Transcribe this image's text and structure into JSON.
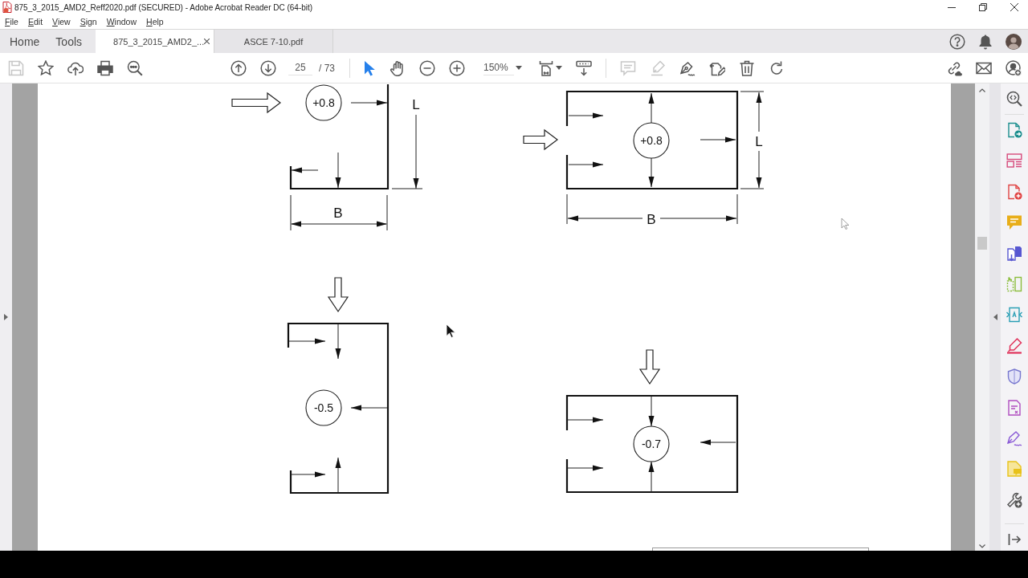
{
  "window": {
    "title": "875_3_2015_AMD2_Reff2020.pdf (SECURED) - Adobe Acrobat Reader DC (64-bit)"
  },
  "menu": [
    "File",
    "Edit",
    "View",
    "Sign",
    "Window",
    "Help"
  ],
  "nav_tabs": [
    {
      "label": "Home",
      "selected": false
    },
    {
      "label": "Tools",
      "selected": false
    }
  ],
  "doc_tabs": [
    {
      "label": "875_3_2015_AMD2_...",
      "selected": true,
      "closable": true
    },
    {
      "label": "ASCE 7-10.pdf",
      "selected": false,
      "closable": false
    }
  ],
  "toolbar": {
    "file_tools": [
      {
        "kind": "save",
        "disabled": true
      },
      {
        "kind": "bookmark",
        "disabled": false
      },
      {
        "kind": "upload",
        "disabled": false
      },
      {
        "kind": "print",
        "disabled": false
      },
      {
        "kind": "find",
        "disabled": false
      }
    ],
    "page_number": "25",
    "page_count": "/ 73",
    "pointer_tools": [
      {
        "kind": "select",
        "selected": true
      },
      {
        "kind": "hand",
        "selected": false
      }
    ],
    "zoom": "150%",
    "edit_tools": [
      {
        "kind": "comment",
        "disabled": true
      },
      {
        "kind": "highlight",
        "disabled": true
      },
      {
        "kind": "sign",
        "disabled": false
      },
      {
        "kind": "edit-page",
        "disabled": false
      },
      {
        "kind": "delete",
        "disabled": false
      },
      {
        "kind": "rotate",
        "disabled": false
      }
    ]
  },
  "document": {
    "figures": [
      {
        "coefficient": "+0.8",
        "length_label": "L",
        "width_label": "B"
      },
      {
        "coefficient": "+0.8",
        "length_label": "L",
        "width_label": "B"
      },
      {
        "coefficient": "-0.5"
      },
      {
        "coefficient": "-0.7"
      }
    ]
  }
}
